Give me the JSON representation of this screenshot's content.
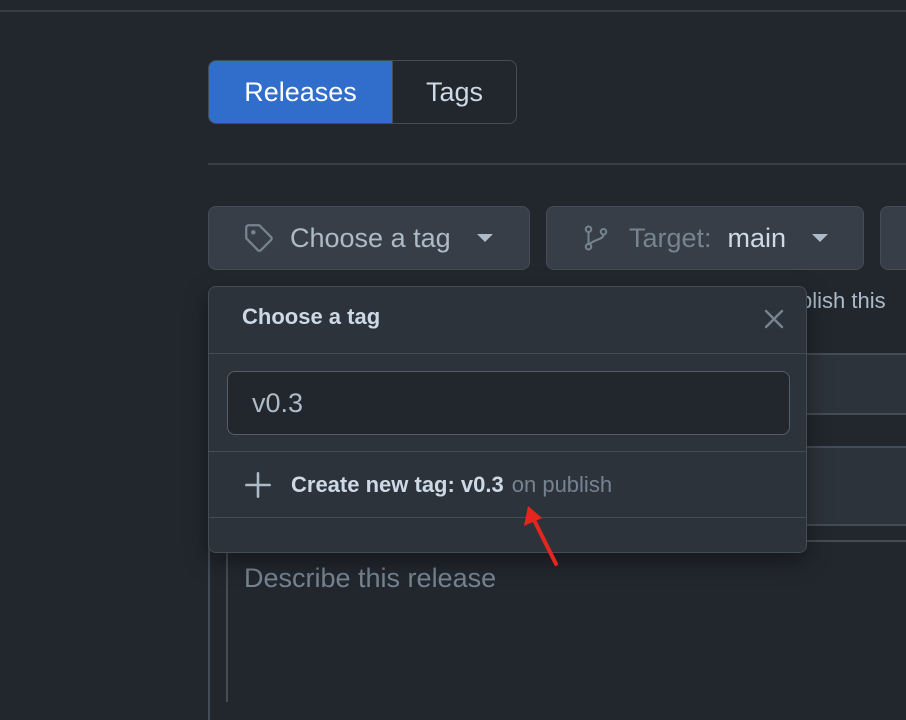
{
  "tabs": {
    "releases": "Releases",
    "tags": "Tags"
  },
  "toolbar": {
    "choose_tag_label": "Choose a tag",
    "target_label": "Target:",
    "target_value": "main"
  },
  "background": {
    "publish_hint": "blish this"
  },
  "description": {
    "placeholder": "Describe this release"
  },
  "popover": {
    "title": "Choose a tag",
    "input_value": "v0.3",
    "create_prefix": "Create new tag: v0.3",
    "create_suffix": "on publish"
  },
  "colors": {
    "accent": "#316dca",
    "annotation_arrow": "#e5261f"
  }
}
